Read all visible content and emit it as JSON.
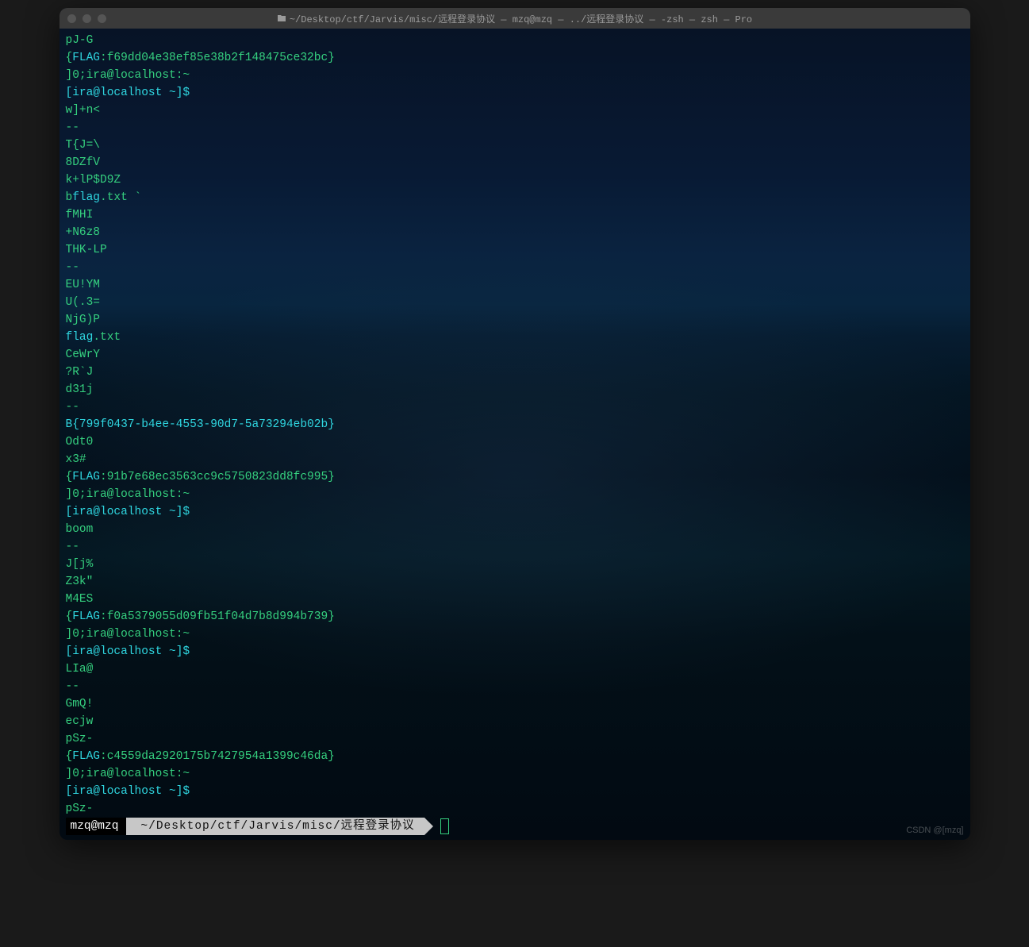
{
  "window": {
    "title": "~/Desktop/ctf/Jarvis/misc/远程登录协议 — mzq@mzq — ../远程登录协议 — -zsh — zsh — Pro"
  },
  "lines": [
    [
      {
        "t": "pJ-G",
        "c": "green"
      }
    ],
    [
      {
        "t": "{",
        "c": "green"
      },
      {
        "t": "FLAG",
        "c": "cyan"
      },
      {
        "t": ":f69dd04e38ef85e38b2f148475ce32bc}",
        "c": "green"
      }
    ],
    [
      {
        "t": "]0;ira@localhost:~",
        "c": "green"
      }
    ],
    [
      {
        "t": "[ira@localhost ~]$",
        "c": "cyan"
      }
    ],
    [
      {
        "t": "w]+n<",
        "c": "green"
      }
    ],
    [
      {
        "t": "--",
        "c": "green"
      }
    ],
    [
      {
        "t": "T{J=\\",
        "c": "green"
      }
    ],
    [
      {
        "t": "8DZfV",
        "c": "green"
      }
    ],
    [
      {
        "t": "k+lP$D9Z",
        "c": "green"
      }
    ],
    [
      {
        "t": "b",
        "c": "green"
      },
      {
        "t": "flag",
        "c": "cyan"
      },
      {
        "t": ".txt `",
        "c": "green"
      }
    ],
    [
      {
        "t": "fMHI",
        "c": "green"
      }
    ],
    [
      {
        "t": "+N6z8",
        "c": "green"
      }
    ],
    [
      {
        "t": "THK-LP",
        "c": "green"
      }
    ],
    [
      {
        "t": "--",
        "c": "green"
      }
    ],
    [
      {
        "t": "EU!YM",
        "c": "green"
      }
    ],
    [
      {
        "t": "U(.3=",
        "c": "green"
      }
    ],
    [
      {
        "t": "NjG)P",
        "c": "green"
      }
    ],
    [
      {
        "t": "flag",
        "c": "cyan"
      },
      {
        "t": ".txt",
        "c": "green"
      }
    ],
    [
      {
        "t": "CeWrY",
        "c": "green"
      }
    ],
    [
      {
        "t": "?R`J",
        "c": "green"
      }
    ],
    [
      {
        "t": "d31j",
        "c": "green"
      }
    ],
    [
      {
        "t": "--",
        "c": "green"
      }
    ],
    [
      {
        "t": "B{799f0437-b4ee-4553-90d7-5a73294eb02b}",
        "c": "cyan"
      }
    ],
    [
      {
        "t": "Odt0",
        "c": "green"
      }
    ],
    [
      {
        "t": "x3#",
        "c": "green"
      }
    ],
    [
      {
        "t": "{",
        "c": "green"
      },
      {
        "t": "FLAG",
        "c": "cyan"
      },
      {
        "t": ":91b7e68ec3563cc9c5750823dd8fc995}",
        "c": "green"
      }
    ],
    [
      {
        "t": "]0;ira@localhost:~",
        "c": "green"
      }
    ],
    [
      {
        "t": "[ira@localhost ~]$",
        "c": "cyan"
      }
    ],
    [
      {
        "t": "boom",
        "c": "green"
      }
    ],
    [
      {
        "t": "--",
        "c": "green"
      }
    ],
    [
      {
        "t": "J[j%",
        "c": "green"
      }
    ],
    [
      {
        "t": "Z3k\"",
        "c": "green"
      }
    ],
    [
      {
        "t": "M4ES",
        "c": "green"
      }
    ],
    [
      {
        "t": "{",
        "c": "green"
      },
      {
        "t": "FLAG",
        "c": "cyan"
      },
      {
        "t": ":f0a5379055d09fb51f04d7b8d994b739}",
        "c": "green"
      }
    ],
    [
      {
        "t": "]0;ira@localhost:~",
        "c": "green"
      }
    ],
    [
      {
        "t": "[ira@localhost ~]$",
        "c": "cyan"
      }
    ],
    [
      {
        "t": "LIa@",
        "c": "green"
      }
    ],
    [
      {
        "t": "--",
        "c": "green"
      }
    ],
    [
      {
        "t": "GmQ!",
        "c": "green"
      }
    ],
    [
      {
        "t": "ecjw",
        "c": "green"
      }
    ],
    [
      {
        "t": "pSz-",
        "c": "green"
      }
    ],
    [
      {
        "t": "{",
        "c": "green"
      },
      {
        "t": "FLAG",
        "c": "cyan"
      },
      {
        "t": ":c4559da2920175b7427954a1399c46da}",
        "c": "green"
      }
    ],
    [
      {
        "t": "]0;ira@localhost:~",
        "c": "green"
      }
    ],
    [
      {
        "t": "[ira@localhost ~]$",
        "c": "cyan"
      }
    ],
    [
      {
        "t": "pSz-",
        "c": "green"
      }
    ]
  ],
  "prompt": {
    "user": "mzq@mzq",
    "path": "~/Desktop/ctf/Jarvis/misc/远程登录协议"
  },
  "watermark": "CSDN @[mzq]"
}
